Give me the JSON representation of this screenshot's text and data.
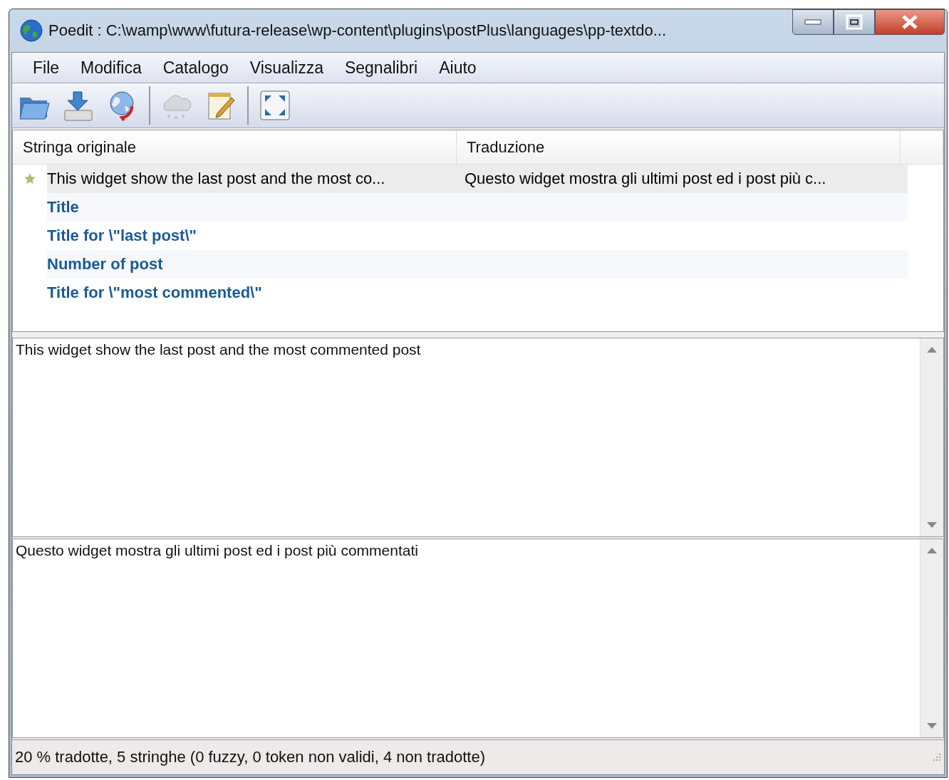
{
  "window": {
    "title": "Poedit : C:\\wamp\\www\\futura-release\\wp-content\\plugins\\postPlus\\languages\\pp-textdo..."
  },
  "menu": [
    "File",
    "Modifica",
    "Catalogo",
    "Visualizza",
    "Segnalibri",
    "Aiuto"
  ],
  "toolbar": [
    {
      "kind": "open",
      "disabled": false
    },
    {
      "kind": "save",
      "disabled": false
    },
    {
      "kind": "update",
      "disabled": false
    },
    {
      "kind": "separator"
    },
    {
      "kind": "fuzzy",
      "disabled": true
    },
    {
      "kind": "comment",
      "disabled": false
    },
    {
      "kind": "separator"
    },
    {
      "kind": "fullscreen",
      "disabled": false
    }
  ],
  "table": {
    "columns": [
      "Stringa originale",
      "Traduzione"
    ],
    "rows": [
      {
        "source": "This widget show the last post and the most co...",
        "translation": "Questo widget mostra gli ultimi post ed i post più c...",
        "translated": true,
        "bookmarked": true,
        "selected": true
      },
      {
        "source": "Title",
        "translated": false,
        "bookmarked": false,
        "selected": false
      },
      {
        "source": "Title for \\\"last post\\\"",
        "translated": false,
        "bookmarked": false,
        "selected": false
      },
      {
        "source": "Number of post",
        "translated": false,
        "bookmarked": false,
        "selected": false
      },
      {
        "source": "Title for \\\"most commented\\\"",
        "translated": false,
        "bookmarked": false,
        "selected": false
      }
    ]
  },
  "source_text": "This widget show the last post and the most commented post",
  "translation_text": "Questo widget mostra gli ultimi post ed i post più commentati",
  "status_bar": "20 % tradotte, 5 stringhe (0 fuzzy, 0 token non validi, 4 non tradotte)"
}
